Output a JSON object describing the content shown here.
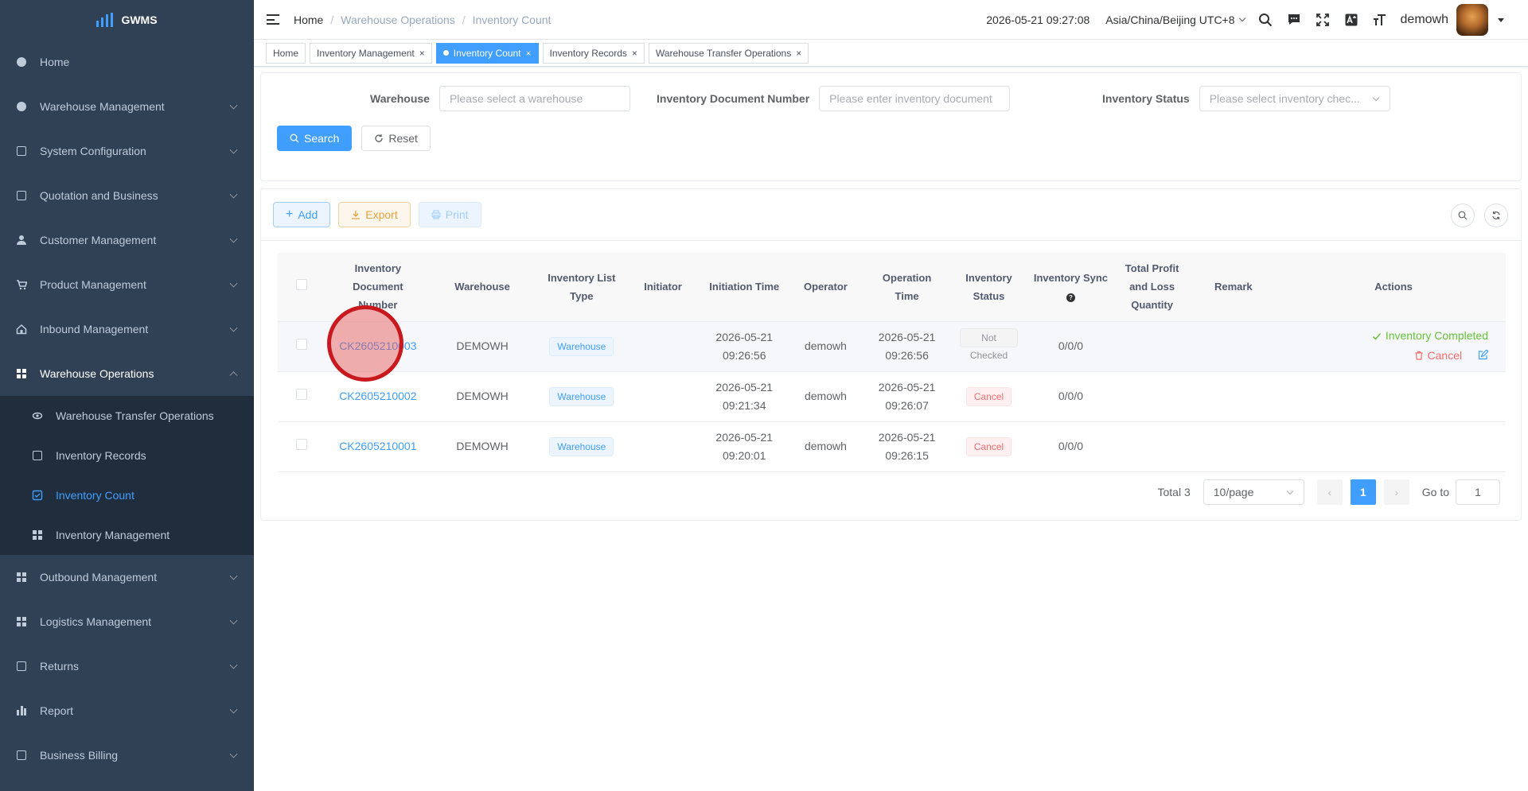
{
  "app": {
    "logo_text": "GWMS"
  },
  "sidebar": {
    "items": [
      {
        "label": "Home",
        "icon": "dashboard-icon"
      },
      {
        "label": "Warehouse Management",
        "icon": "globe-icon"
      },
      {
        "label": "System Configuration",
        "icon": "config-icon"
      },
      {
        "label": "Quotation and Business",
        "icon": "document-icon"
      },
      {
        "label": "Customer Management",
        "icon": "person-icon"
      },
      {
        "label": "Product Management",
        "icon": "cart-icon"
      },
      {
        "label": "Inbound Management",
        "icon": "house-icon"
      },
      {
        "label": "Warehouse Operations",
        "icon": "table-icon"
      },
      {
        "label": "Outbound Management",
        "icon": "grid-icon"
      },
      {
        "label": "Logistics Management",
        "icon": "grid-icon"
      },
      {
        "label": "Returns",
        "icon": "document-icon"
      },
      {
        "label": "Report",
        "icon": "chart-icon"
      },
      {
        "label": "Business Billing",
        "icon": "document-icon"
      }
    ],
    "submenu": [
      {
        "label": "Warehouse Transfer Operations",
        "icon": "eye-icon"
      },
      {
        "label": "Inventory Records",
        "icon": "edit-doc-icon"
      },
      {
        "label": "Inventory Count",
        "icon": "checkbox-icon"
      },
      {
        "label": "Inventory Management",
        "icon": "table-icon"
      }
    ]
  },
  "header": {
    "breadcrumb": [
      "Home",
      "Warehouse Operations",
      "Inventory Count"
    ],
    "datetime": "2026-05-21 09:27:08",
    "timezone": "Asia/China/Beijing UTC+8",
    "username": "demowh"
  },
  "tags": [
    {
      "label": "Home"
    },
    {
      "label": "Inventory Management"
    },
    {
      "label": "Inventory Count"
    },
    {
      "label": "Inventory Records"
    },
    {
      "label": "Warehouse Transfer Operations"
    }
  ],
  "search": {
    "warehouse_label": "Warehouse",
    "warehouse_placeholder": "Please select a warehouse",
    "doc_label": "Inventory Document Number",
    "doc_placeholder": "Please enter inventory document",
    "status_label": "Inventory Status",
    "status_placeholder": "Please select inventory chec...",
    "search_btn": "Search",
    "reset_btn": "Reset"
  },
  "toolbar": {
    "add": "Add",
    "export": "Export",
    "print": "Print"
  },
  "table": {
    "headers": [
      [
        "Inventory",
        "Document",
        "Number"
      ],
      [
        "Warehouse"
      ],
      [
        "Inventory List",
        "Type"
      ],
      [
        "Initiator"
      ],
      [
        "Initiation Time"
      ],
      [
        "Operator"
      ],
      [
        "Operation",
        "Time"
      ],
      [
        "Inventory",
        "Status"
      ],
      [
        "Inventory Sync"
      ],
      [
        "Total Profit",
        "and Loss",
        "Quantity"
      ],
      [
        "Remark"
      ],
      [
        "Actions"
      ]
    ],
    "rows": [
      {
        "doc_no": "CK2605210003",
        "warehouse": "DEMOWH",
        "list_type": "Warehouse",
        "initiator": "",
        "init_date": "2026-05-21",
        "init_time": "09:26:56",
        "operator": "demowh",
        "op_date": "2026-05-21",
        "op_time": "09:26:56",
        "status": "Not Checked",
        "sync": "0/0/0",
        "profit_loss": "",
        "remark": "",
        "action_complete": "Inventory Completed",
        "action_cancel": "Cancel"
      },
      {
        "doc_no": "CK2605210002",
        "warehouse": "DEMOWH",
        "list_type": "Warehouse",
        "initiator": "",
        "init_date": "2026-05-21",
        "init_time": "09:21:34",
        "operator": "demowh",
        "op_date": "2026-05-21",
        "op_time": "09:26:07",
        "status": "Cancel",
        "sync": "0/0/0",
        "profit_loss": "",
        "remark": ""
      },
      {
        "doc_no": "CK2605210001",
        "warehouse": "DEMOWH",
        "list_type": "Warehouse",
        "initiator": "",
        "init_date": "2026-05-21",
        "init_time": "09:20:01",
        "operator": "demowh",
        "op_date": "2026-05-21",
        "op_time": "09:26:15",
        "status": "Cancel",
        "sync": "0/0/0",
        "profit_loss": "",
        "remark": ""
      }
    ]
  },
  "pagination": {
    "total": "Total 3",
    "page_size": "10/page",
    "current_page": "1",
    "goto_label": "Go to",
    "goto_value": "1"
  },
  "colors": {
    "sidebar_bg": "#304156",
    "primary": "#409eff",
    "success": "#67c23a",
    "danger": "#f56c6c",
    "warning": "#e6a23c"
  }
}
